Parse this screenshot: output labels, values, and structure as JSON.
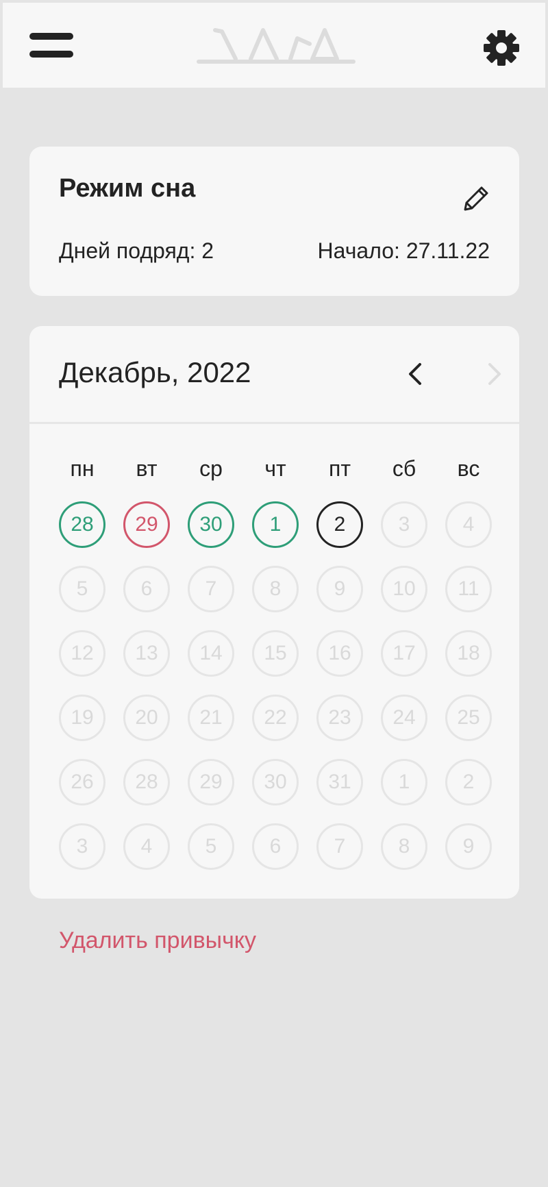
{
  "icons": {
    "menu": "hamburger-menu-icon",
    "logo": "app-logo",
    "settings": "gear-icon",
    "edit": "pencil-icon",
    "prev": "chevron-left-icon",
    "next": "chevron-right-icon"
  },
  "colors": {
    "done": "#2e9e78",
    "missed": "#d2566b",
    "today": "#232323",
    "inactive": "#e5e5e5",
    "delete": "#d2566b"
  },
  "habit": {
    "title": "Режим сна",
    "streak": "Дней подряд: 2",
    "start": "Начало: 27.11.22"
  },
  "calendar": {
    "month": "Декабрь, 2022",
    "weekdays": [
      "пн",
      "вт",
      "ср",
      "чт",
      "пт",
      "сб",
      "вс"
    ],
    "days": [
      {
        "label": "28",
        "state": "done"
      },
      {
        "label": "29",
        "state": "missed"
      },
      {
        "label": "30",
        "state": "done"
      },
      {
        "label": "1",
        "state": "done"
      },
      {
        "label": "2",
        "state": "today"
      },
      {
        "label": "3",
        "state": "inactive"
      },
      {
        "label": "4",
        "state": "inactive"
      },
      {
        "label": "5",
        "state": "inactive"
      },
      {
        "label": "6",
        "state": "inactive"
      },
      {
        "label": "7",
        "state": "inactive"
      },
      {
        "label": "8",
        "state": "inactive"
      },
      {
        "label": "9",
        "state": "inactive"
      },
      {
        "label": "10",
        "state": "inactive"
      },
      {
        "label": "11",
        "state": "inactive"
      },
      {
        "label": "12",
        "state": "inactive"
      },
      {
        "label": "13",
        "state": "inactive"
      },
      {
        "label": "14",
        "state": "inactive"
      },
      {
        "label": "15",
        "state": "inactive"
      },
      {
        "label": "16",
        "state": "inactive"
      },
      {
        "label": "17",
        "state": "inactive"
      },
      {
        "label": "18",
        "state": "inactive"
      },
      {
        "label": "19",
        "state": "inactive"
      },
      {
        "label": "20",
        "state": "inactive"
      },
      {
        "label": "21",
        "state": "inactive"
      },
      {
        "label": "22",
        "state": "inactive"
      },
      {
        "label": "23",
        "state": "inactive"
      },
      {
        "label": "24",
        "state": "inactive"
      },
      {
        "label": "25",
        "state": "inactive"
      },
      {
        "label": "26",
        "state": "inactive"
      },
      {
        "label": "28",
        "state": "inactive"
      },
      {
        "label": "29",
        "state": "inactive"
      },
      {
        "label": "30",
        "state": "inactive"
      },
      {
        "label": "31",
        "state": "inactive"
      },
      {
        "label": "1",
        "state": "inactive"
      },
      {
        "label": "2",
        "state": "inactive"
      },
      {
        "label": "3",
        "state": "inactive"
      },
      {
        "label": "4",
        "state": "inactive"
      },
      {
        "label": "5",
        "state": "inactive"
      },
      {
        "label": "6",
        "state": "inactive"
      },
      {
        "label": "7",
        "state": "inactive"
      },
      {
        "label": "8",
        "state": "inactive"
      },
      {
        "label": "9",
        "state": "inactive"
      }
    ]
  },
  "actions": {
    "delete_habit": "Удалить привычку"
  }
}
